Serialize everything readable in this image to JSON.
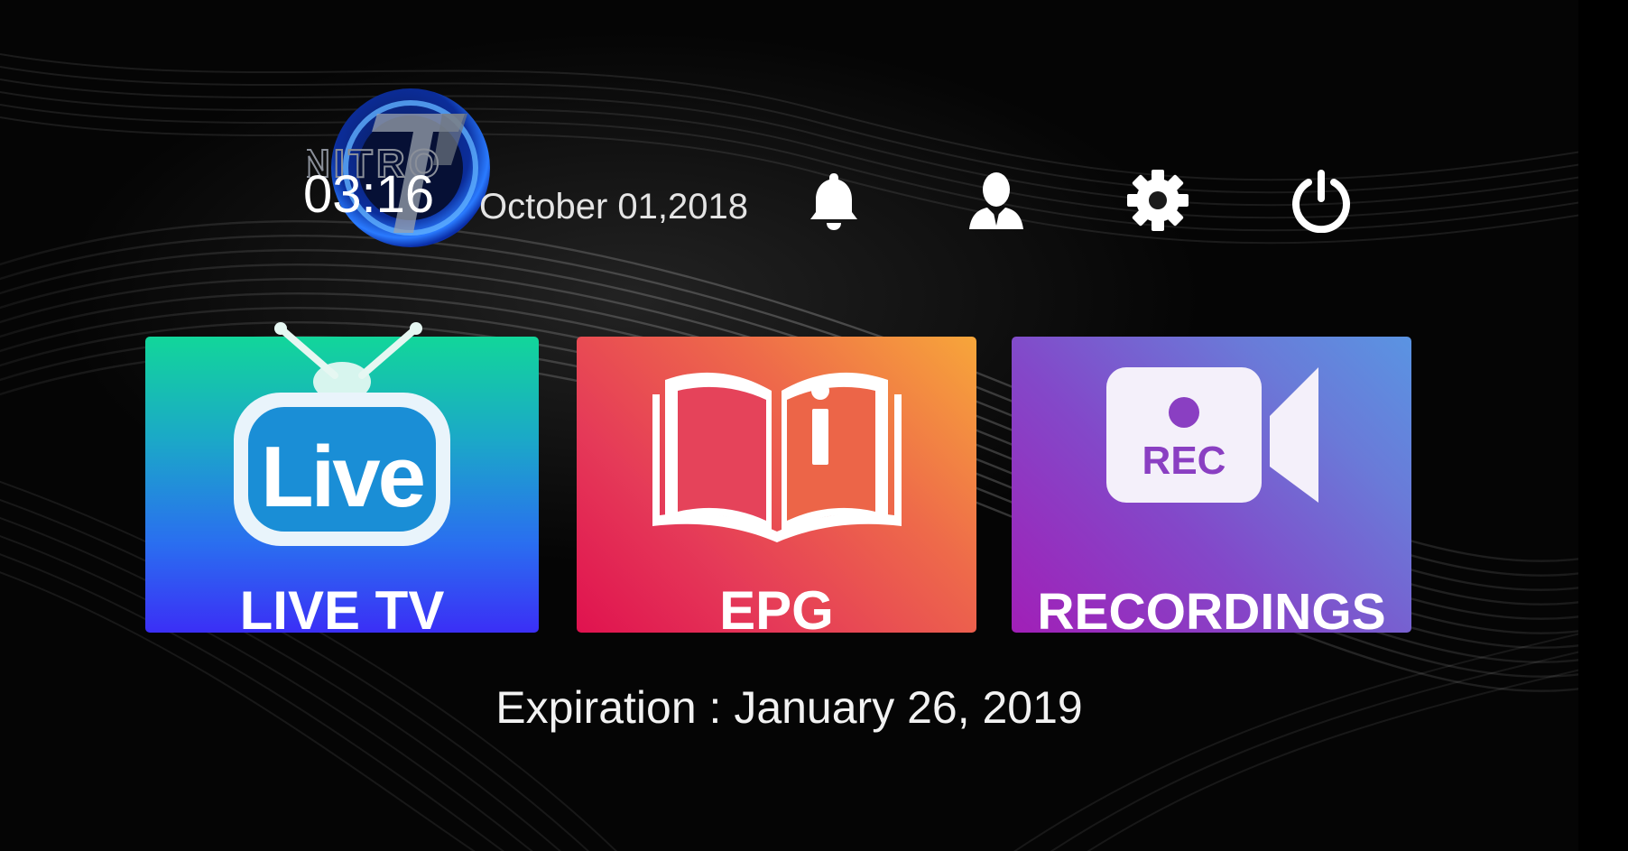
{
  "logo": {
    "brand_text": "NITRO",
    "monogram": "TV"
  },
  "header": {
    "time": "03:16",
    "date": "October 01,2018"
  },
  "top_actions": [
    {
      "icon": "bell-icon",
      "label": "Notifications"
    },
    {
      "icon": "user-icon",
      "label": "Account"
    },
    {
      "icon": "gear-icon",
      "label": "Settings"
    },
    {
      "icon": "power-icon",
      "label": "Power"
    }
  ],
  "tiles": {
    "live_tv": {
      "label": "LIVE TV",
      "icon_text": "Live",
      "icon": "live-tv-icon"
    },
    "epg": {
      "label": "EPG",
      "icon": "book-info-icon"
    },
    "recordings": {
      "label": "RECORDINGS",
      "icon_text": "REC",
      "icon": "video-camera-icon"
    }
  },
  "expiration": {
    "label": "Expiration",
    "separator": " : ",
    "date": "January 26, 2019"
  },
  "colors": {
    "live_tile_top": "#12d69a",
    "live_tile_bottom": "#3b2ff6",
    "epg_tile_start": "#e0124f",
    "epg_tile_end": "#f7a63a",
    "rec_tile_start": "#a11fb7",
    "rec_tile_end": "#5a94e2",
    "background": "#050505"
  }
}
